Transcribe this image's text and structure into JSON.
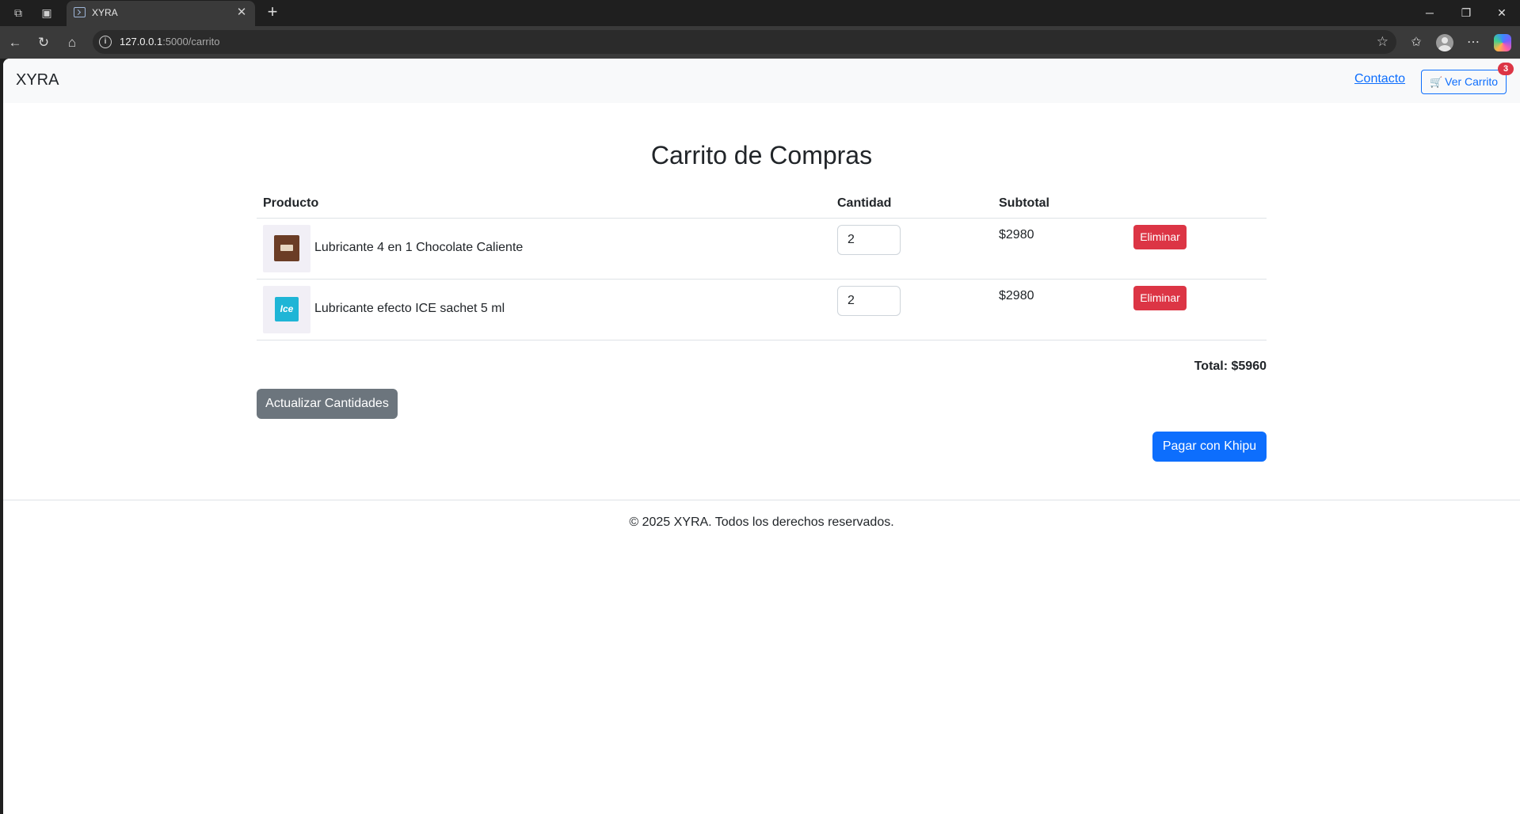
{
  "browser": {
    "tab_title": "XYRA",
    "tab_close": "✕",
    "new_tab": "+",
    "url_host": "127.0.0.1",
    "url_path": ":5000/carrito",
    "window_minimize": "─",
    "window_restore": "❐",
    "window_close": "✕"
  },
  "navbar": {
    "brand": "XYRA",
    "contact": "Contacto",
    "cart_icon": "🛒",
    "cart_label": "Ver Carrito",
    "cart_count": "3"
  },
  "page": {
    "title": "Carrito de Compras"
  },
  "table": {
    "headers": {
      "product": "Producto",
      "quantity": "Cantidad",
      "subtotal": "Subtotal"
    },
    "rows": [
      {
        "image": "chocolate-lubricant-image",
        "name": "Lubricante 4 en 1 Chocolate Caliente",
        "quantity": "2",
        "subtotal": "$2980",
        "remove": "Eliminar"
      },
      {
        "image": "ice-lubricant-image",
        "image_text": "Ice",
        "name": "Lubricante efecto ICE sachet 5 ml",
        "quantity": "2",
        "subtotal": "$2980",
        "remove": "Eliminar"
      }
    ]
  },
  "summary": {
    "total": "Total: $5960",
    "update_button": "Actualizar Cantidades",
    "pay_button": "Pagar con Khipu"
  },
  "footer": {
    "text": "© 2025 XYRA. Todos los derechos reservados."
  },
  "colors": {
    "primary": "#0d6efd",
    "danger": "#dc3545",
    "secondary": "#6c757d"
  }
}
